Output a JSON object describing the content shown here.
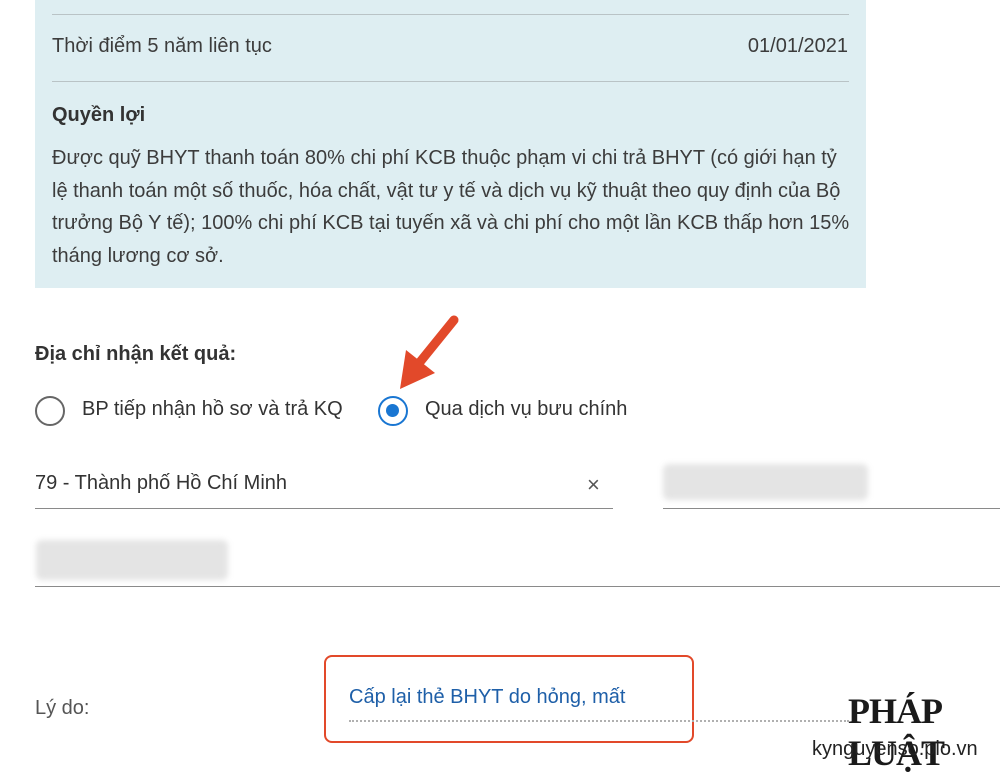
{
  "info_panel": {
    "row_label": "Thời điểm 5 năm liên tục",
    "row_value": "01/01/2021",
    "benefit_title": "Quyền lợi",
    "benefit_text": "Được quỹ BHYT thanh toán 80% chi phí KCB thuộc phạm vi chi trả BHYT (có giới hạn tỷ lệ thanh toán một số thuốc, hóa chất, vật tư y tế và dịch vụ kỹ thuật theo quy định của Bộ trưởng Bộ Y tế); 100% chi phí KCB tại tuyến xã và chi phí cho một lần KCB thấp hơn 15% tháng lương cơ sở."
  },
  "address": {
    "label": "Địa chỉ nhận kết quả:",
    "options": [
      {
        "label": "BP tiếp nhận hồ sơ và trả KQ",
        "checked": false
      },
      {
        "label": "Qua dịch vụ bưu chính",
        "checked": true
      }
    ],
    "city_value": "79 - Thành phố Hồ Chí Minh",
    "clear_symbol": "×"
  },
  "reason": {
    "label": "Lý do:",
    "value": "Cấp lại thẻ BHYT do hỏng, mất"
  },
  "watermark": {
    "logo": "PHÁP LUẬT",
    "site": "kynguyenso.plo.vn"
  },
  "colors": {
    "accent": "#1976d2",
    "highlight": "#e2492a",
    "panel_bg": "#deeef2",
    "link": "#1e5fa8"
  }
}
